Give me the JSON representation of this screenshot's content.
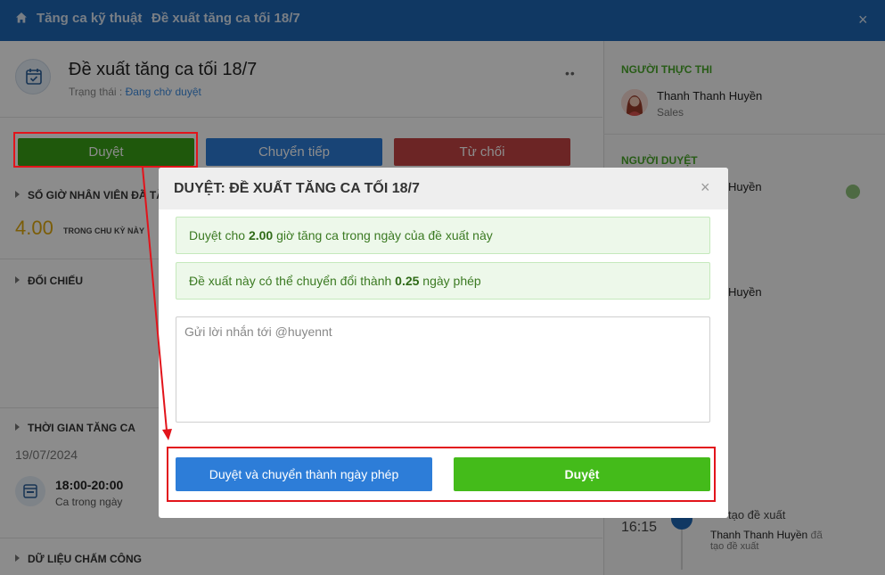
{
  "breadcrumb": {
    "parent": "Tăng ca kỹ thuật",
    "separator": "›",
    "current": "Đề xuất tăng ca tối 18/7",
    "close": "×"
  },
  "request": {
    "title": "Đề xuất tăng ca tối 18/7",
    "status_label": "Trạng thái :",
    "status_value": "Đang chờ duyệt",
    "more": "••"
  },
  "actions": {
    "approve": "Duyệt",
    "forward": "Chuyển tiếp",
    "reject": "Từ chối"
  },
  "sections": {
    "hours_title": "SỐ GIỜ NHÂN VIÊN ĐÃ TĂNG",
    "hours_value": "4.00",
    "hours_caption": "TRONG CHU KỲ NÀY",
    "compare_title": "ĐỐI CHIẾU",
    "overtime_title": "THỜI GIAN TĂNG CA",
    "overtime_date": "19/07/2024",
    "overtime_range": "18:00-20:00",
    "overtime_sub": "Ca trong ngày",
    "attendance_title": "DỮ LIỆU CHẤM CÔNG"
  },
  "right_panel": {
    "executor_heading": "NGƯỜI THỰC THI",
    "executor_name": "Thanh Thanh Huyền",
    "executor_role": "Sales",
    "approver_heading": "NGƯỜI DUYỆT",
    "approver_name_1": "Huyền",
    "approver_name_2": "Huyền",
    "timeline_time": "16:15",
    "timeline_action": "tạo đề xuất",
    "timeline_actor": "Thanh Thanh Huyền",
    "timeline_detail_1": "đã",
    "timeline_detail_2": "tạo đề xuất"
  },
  "modal": {
    "title": "DUYỆT: ĐỀ XUẤT TĂNG CA TỐI 18/7",
    "close": "×",
    "info1_pre": "Duyệt cho ",
    "info1_value": "2.00",
    "info1_post": " giờ tăng ca trong ngày của đề xuất này",
    "info2_pre": "Đề xuất này có thể chuyển đổi thành ",
    "info2_value": "0.25",
    "info2_post": " ngày phép",
    "message_placeholder": "Gửi lời nhắn tới @huyennt",
    "convert_button": "Duyệt và chuyển thành ngày phép",
    "approve_button": "Duyệt"
  },
  "colors": {
    "topbar": "#1e66b4",
    "approve": "#44bb1a",
    "forward": "#2d7dd8",
    "reject": "#c54444",
    "highlight": "#e2141b"
  }
}
